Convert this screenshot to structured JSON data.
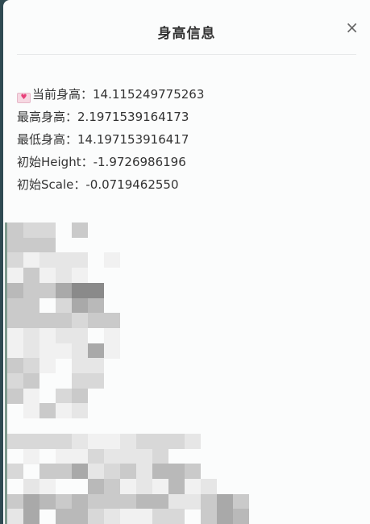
{
  "dialog": {
    "title": "身高信息",
    "close_symbol": "×",
    "icons": {
      "close": "close-icon",
      "heart": "heart-envelope-icon"
    }
  },
  "info": {
    "rows": [
      {
        "label": "当前身高：",
        "value": "14.115249775263"
      },
      {
        "label": "最高身高：",
        "value": "2.1971539164173"
      },
      {
        "label": "最低身高：",
        "value": "14.197153916417"
      },
      {
        "label": "初始Height：",
        "value": "-1.9726986196"
      },
      {
        "label": "初始Scale：",
        "value": "-0.0719462550"
      }
    ]
  },
  "colors": {
    "backdrop": "#2f4a52",
    "panel": "#fbfcfc",
    "text": "#333333",
    "heart": "#e8407a"
  }
}
